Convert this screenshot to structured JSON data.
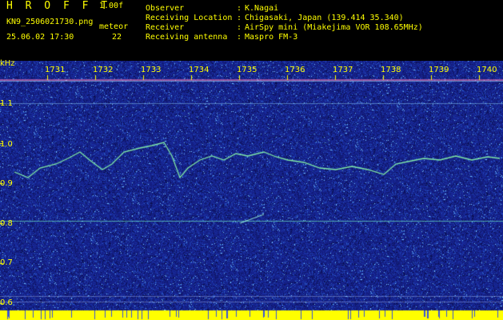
{
  "header": {
    "app_name": "H R O F F T",
    "version": "1.00f",
    "file_name": "KN9_2506021730.png",
    "station_tag": "meteor",
    "timestamp": "25.06.02 17:30",
    "count": "22",
    "fields": [
      {
        "label": "Observer",
        "value": "K.Nagai"
      },
      {
        "label": "Receiving Location",
        "value": "Chigasaki, Japan (139.414 35.340)"
      },
      {
        "label": "Receiver",
        "value": "AirSpy mini (Miakejima VOR 108.65MHz)"
      },
      {
        "label": "Receiving antenna",
        "value": "Maspro FM-3"
      }
    ],
    "separator": ":"
  },
  "axis": {
    "unit": "kHz",
    "y_ticks": [
      "1.1",
      "1.0",
      "0.9",
      "0.8",
      "0.7",
      "0.6"
    ],
    "time_ticks": [
      "1731",
      "1732",
      "1733",
      "1734",
      "1735",
      "1736",
      "1737",
      "1738",
      "1739",
      "1740"
    ]
  },
  "colors": {
    "text": "#ffff00",
    "background": "#000000",
    "noise_base": "#1a2a9a",
    "trace": "#7fffb0",
    "baseline": "#ffff00"
  }
}
